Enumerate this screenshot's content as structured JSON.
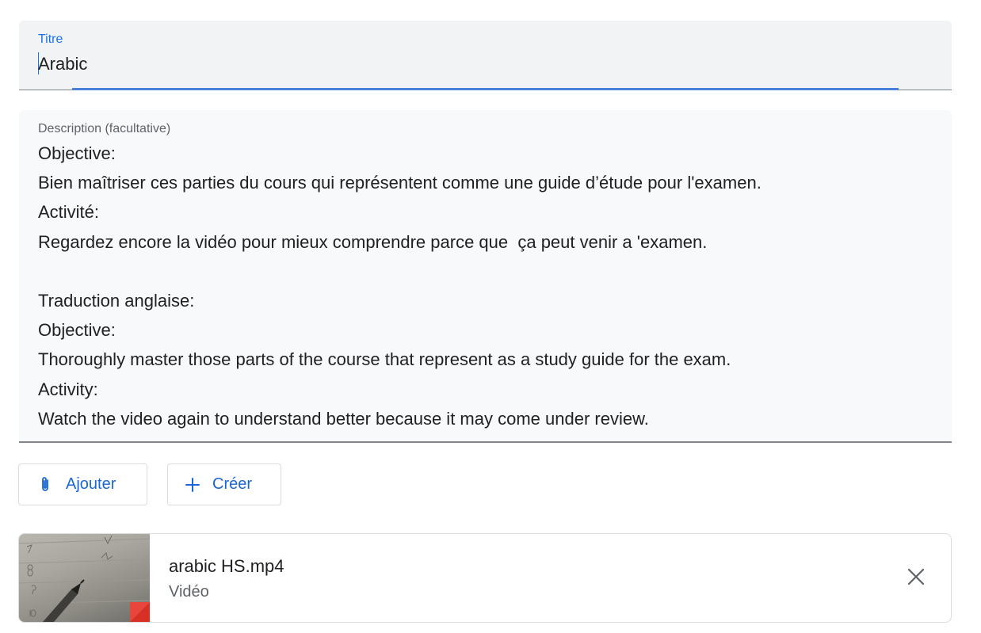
{
  "title_field": {
    "label": "Titre",
    "value": "Arabic"
  },
  "description_field": {
    "label": "Description (facultative)",
    "lines": [
      "Objective:",
      "Bien maîtriser ces parties du cours qui représentent comme une guide d’étude pour l'examen.",
      "Activité:",
      "Regardez encore la vidéo pour mieux comprendre parce que  ça peut venir a 'examen.",
      "",
      "Traduction anglaise:",
      "Objective:",
      "Thoroughly master those parts of the course that represent as a study guide for the exam.",
      "Activity:",
      "Watch the video again to understand better because it may come under review."
    ]
  },
  "buttons": {
    "add_label": "Ajouter",
    "add_icon": "paperclip-icon",
    "create_label": "Créer",
    "create_icon": "plus-icon"
  },
  "attachment": {
    "name": "arabic HS.mp4",
    "type": "Vidéo",
    "remove_icon": "close-icon"
  },
  "colors": {
    "accent": "#1a73e8",
    "field_background": "#f1f3f4",
    "text_primary": "#202124",
    "text_secondary": "#5f6368"
  }
}
